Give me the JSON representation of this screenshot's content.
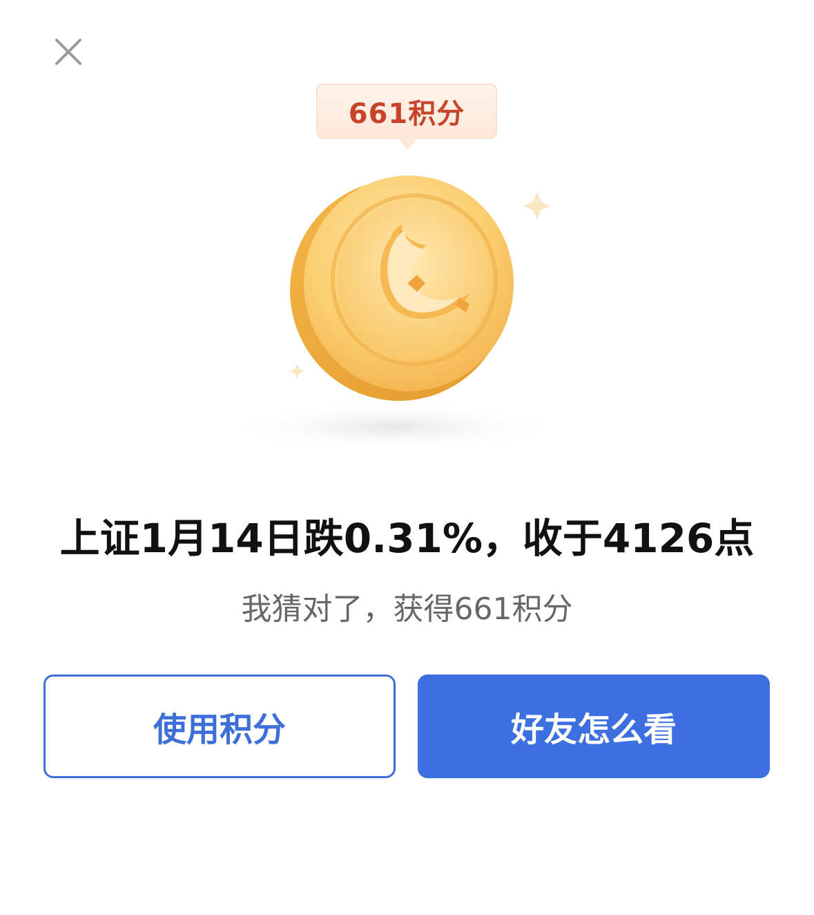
{
  "close": {
    "icon": "close-icon"
  },
  "reward": {
    "bubble_text": "661积分",
    "coin_icon": "gold-coin-icon"
  },
  "result": {
    "headline": "上证1月14日跌0.31%，收于4126点",
    "subline": "我猜对了，获得661积分"
  },
  "actions": {
    "use_points_label": "使用积分",
    "friends_view_label": "好友怎么看"
  },
  "colors": {
    "primary": "#3d6fe0",
    "bubble_text": "#c8432b",
    "coin": "#f6bd53"
  }
}
